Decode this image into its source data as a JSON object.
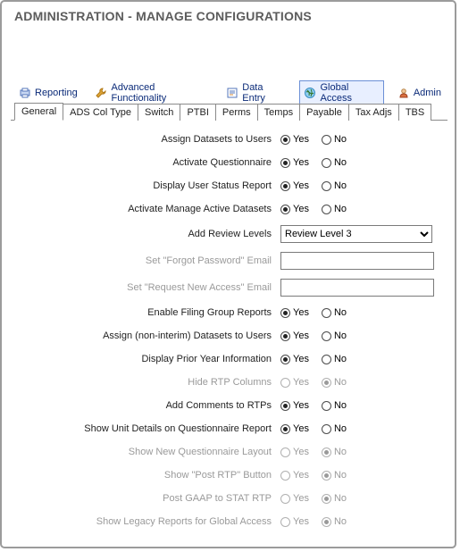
{
  "title": "ADMINISTRATION - MANAGE CONFIGURATIONS",
  "toolbar": {
    "reporting": "Reporting",
    "advanced": "Advanced Functionality",
    "dataentry": "Data Entry",
    "global": "Global Access",
    "admin": "Admin"
  },
  "tabs": {
    "general": "General",
    "ads": "ADS Col Type",
    "switch": "Switch",
    "ptbi": "PTBI",
    "perms": "Perms",
    "temps": "Temps",
    "payable": "Payable",
    "taxadjs": "Tax Adjs",
    "tbs": "TBS"
  },
  "labels": {
    "assign_datasets": "Assign Datasets to Users",
    "activate_q": "Activate Questionnaire",
    "display_status": "Display User Status Report",
    "activate_mad": "Activate Manage Active Datasets",
    "add_review": "Add Review Levels",
    "forgot_pw": "Set \"Forgot Password\" Email",
    "request_access": "Set \"Request New Access\" Email",
    "enable_filing": "Enable Filing Group Reports",
    "assign_noninterim": "Assign (non-interim) Datasets to Users",
    "display_prior": "Display Prior Year Information",
    "hide_rtp": "Hide RTP Columns",
    "add_comments": "Add Comments to RTPs",
    "show_unit": "Show Unit Details on Questionnaire Report",
    "show_new_q": "Show New Questionnaire Layout",
    "show_post_rtp": "Show \"Post RTP\" Button",
    "post_gaap": "Post GAAP to STAT RTP",
    "show_legacy": "Show Legacy Reports for Global Access"
  },
  "opts": {
    "yes": "Yes",
    "no": "No"
  },
  "values": {
    "review_level": "Review Level 3",
    "forgot_pw_email": "",
    "request_access_email": ""
  }
}
